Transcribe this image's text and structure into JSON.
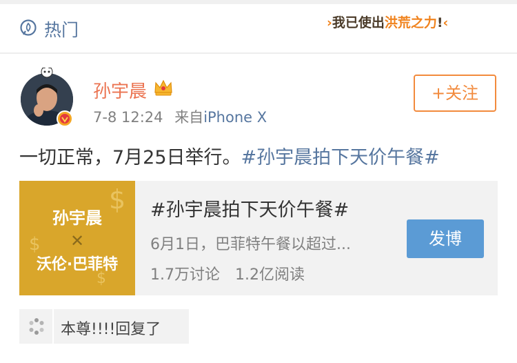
{
  "header": {
    "title": "热门",
    "slogan": {
      "before": "我已使出",
      "highlight": "洪荒之力",
      "after": "!"
    }
  },
  "post": {
    "user_name": "孙宇晨",
    "time": "7-8 12:24",
    "source_prefix": "来自",
    "source": "iPhone X",
    "follow_label": "+关注",
    "text": "一切正常，7月25日举行。",
    "hashtag": "#孙宇晨拍下天价午餐#"
  },
  "topic_card": {
    "title": "#孙宇晨拍下天价午餐#",
    "description": "6月1日，巴菲特午餐以超过...",
    "discussions": "1.7万讨论",
    "reads": "1.2亿阅读",
    "post_button": "发博",
    "thumb_line1": "孙宇晨",
    "thumb_cross": "✕",
    "thumb_line2": "沃伦·巴菲特"
  },
  "reply": {
    "text": "本尊!!!!回复了"
  },
  "colors": {
    "link": "#56769f",
    "username": "#eb7350",
    "follow": "#f28a3c",
    "post_button": "#5b9bd5",
    "thumb_bg": "#d9a62b"
  }
}
